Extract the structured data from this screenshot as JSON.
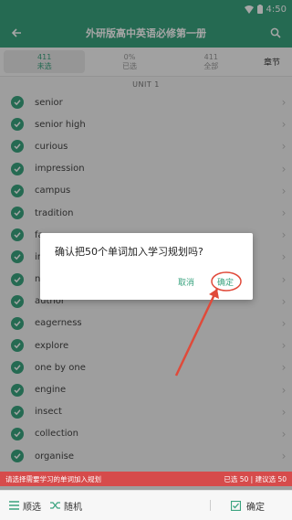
{
  "status_bar": {
    "time": "4:50",
    "wifi_icon": "wifi-icon",
    "battery_icon": "battery-icon"
  },
  "app_bar": {
    "title": "外研版高中英语必修第一册",
    "back_icon": "arrow-back-icon",
    "search_icon": "search-icon"
  },
  "tabs": [
    {
      "count": "411",
      "label": "未选"
    },
    {
      "count": "0%",
      "label": "已选"
    },
    {
      "count": "411",
      "label": "全部"
    }
  ],
  "chapter_label": "章节",
  "unit_header": "UNIT 1",
  "words": [
    "senior",
    "senior high",
    "curious",
    "impression",
    "campus",
    "tradition",
    "fa",
    "in",
    "n",
    "author",
    "eagerness",
    "explore",
    "one by one",
    "engine",
    "insect",
    "collection",
    "organise"
  ],
  "dialog": {
    "message": "确认把50个单词加入学习规划吗?",
    "cancel": "取消",
    "ok": "确定"
  },
  "banner": {
    "left": "请选择需要学习的单词加入规划",
    "right": "已选 50 | 建议选 50"
  },
  "bottom_bar": {
    "filter": "顺选",
    "random": "随机",
    "confirm": "确定"
  },
  "colors": {
    "accent": "#3aa37f",
    "alert": "#d64b4b",
    "arrow": "#e04a3a"
  }
}
